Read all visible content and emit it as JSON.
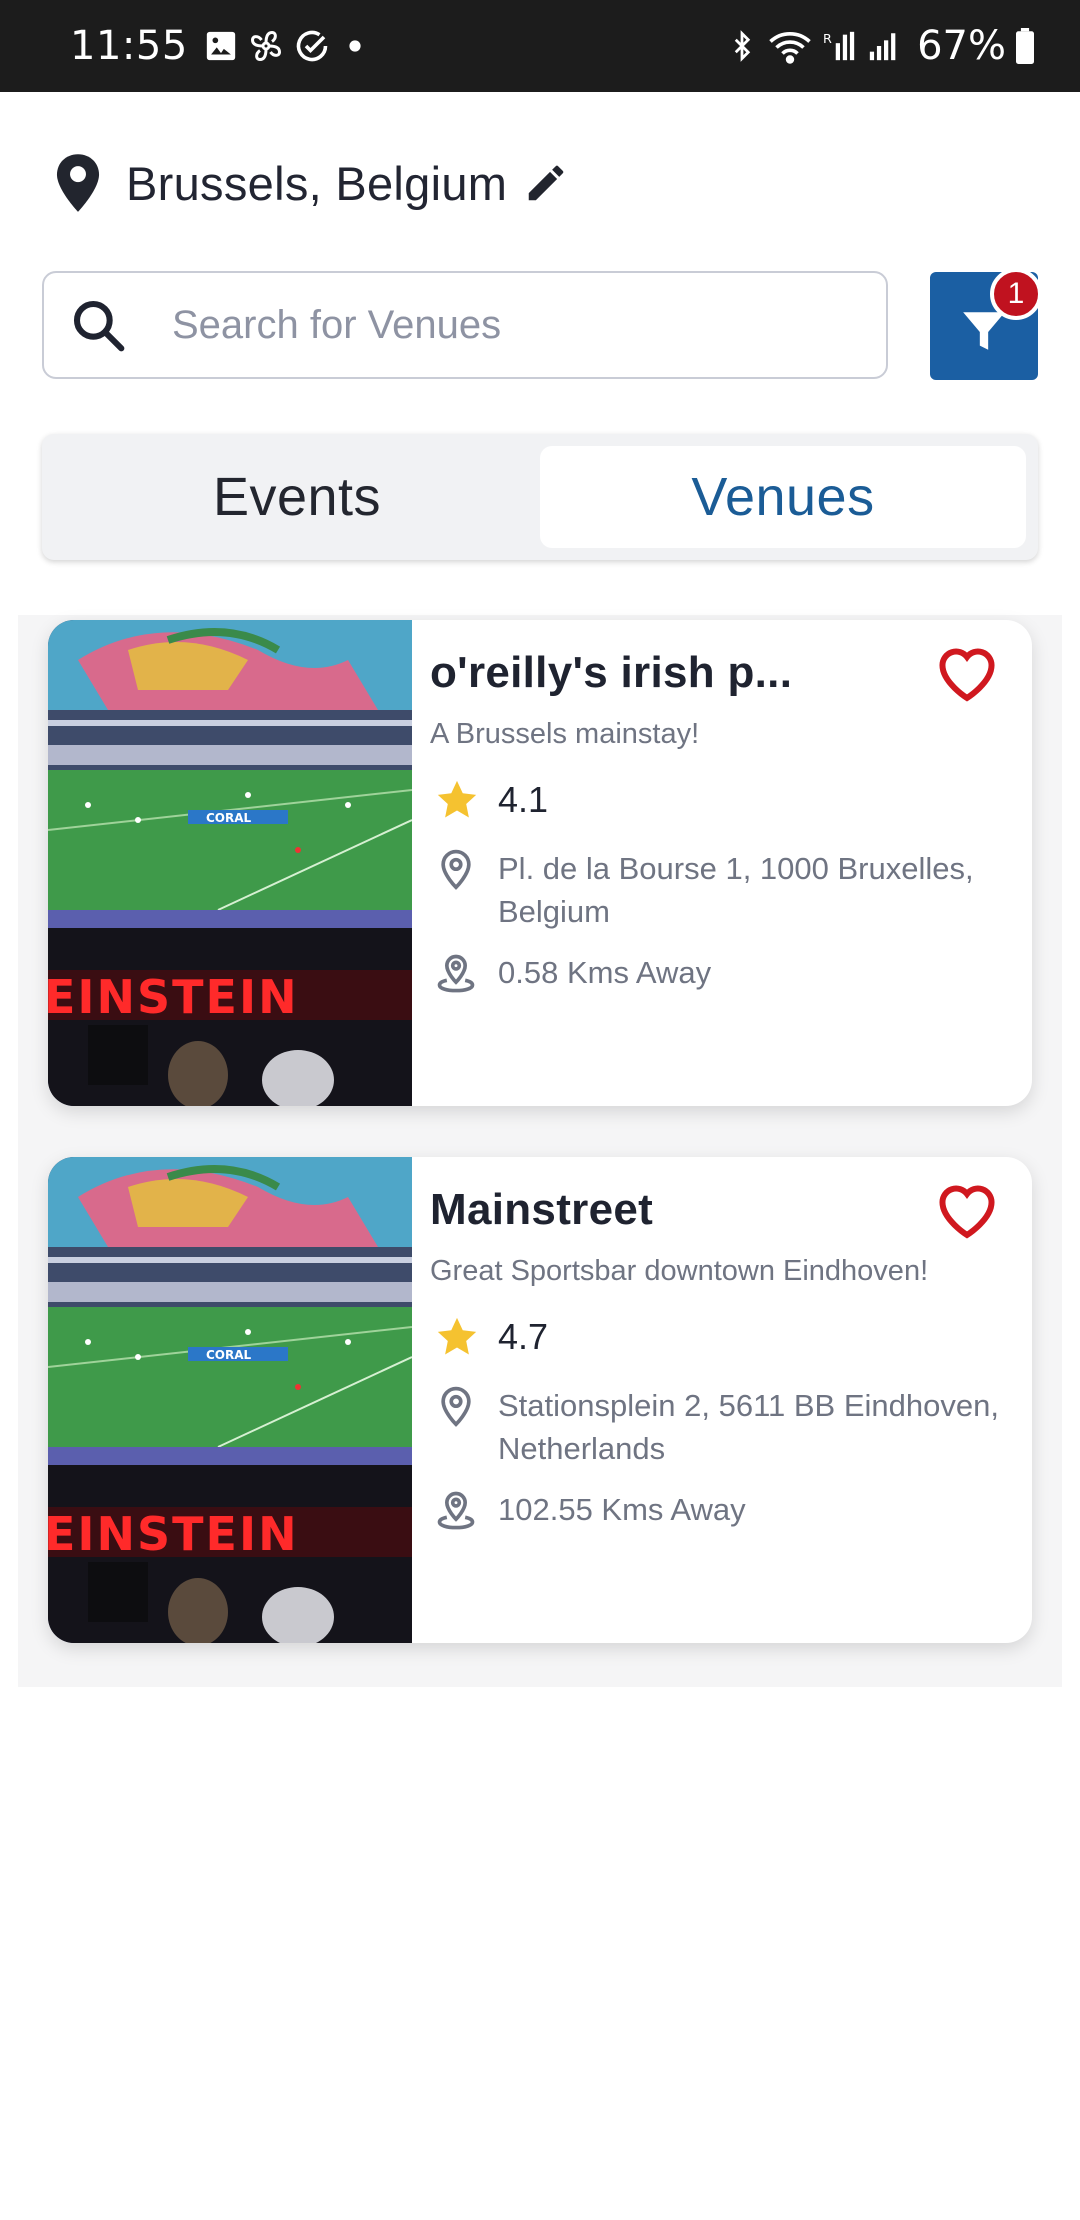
{
  "status_bar": {
    "time": "11:55",
    "battery": "67%",
    "icons": [
      "gallery-icon",
      "fan-icon",
      "check-circle-icon",
      "dot-icon",
      "bluetooth-icon",
      "wifi-icon",
      "signal-r-icon",
      "signal-icon",
      "battery-icon"
    ]
  },
  "location": {
    "text": "Brussels, Belgium"
  },
  "search": {
    "placeholder": "Search for Venues",
    "value": ""
  },
  "filter": {
    "badge": "1",
    "color": "#1b5fa3",
    "badge_color": "#c0121f"
  },
  "tabs": [
    {
      "label": "Events",
      "selected": false
    },
    {
      "label": "Venues",
      "selected": true
    }
  ],
  "venues": [
    {
      "name": "o'reilly's irish p...",
      "description": "A Brussels mainstay!",
      "rating": "4.1",
      "address": "Pl. de la Bourse 1, 1000 Bruxelles, Belgium",
      "distance": "0.58 Kms Away",
      "image_sign": "EINSTEIN",
      "image_ad": "CORAL"
    },
    {
      "name": "Mainstreet",
      "description": "Great Sportsbar downtown Eindhoven!",
      "rating": "4.7",
      "address": "Stationsplein 2, 5611 BB Eindhoven, Netherlands",
      "distance": "102.55 Kms Away",
      "image_sign": "EINSTEIN",
      "image_ad": "CORAL"
    }
  ],
  "colors": {
    "accent": "#1b5c96",
    "heart": "#d0181f",
    "star": "#f5c230"
  }
}
